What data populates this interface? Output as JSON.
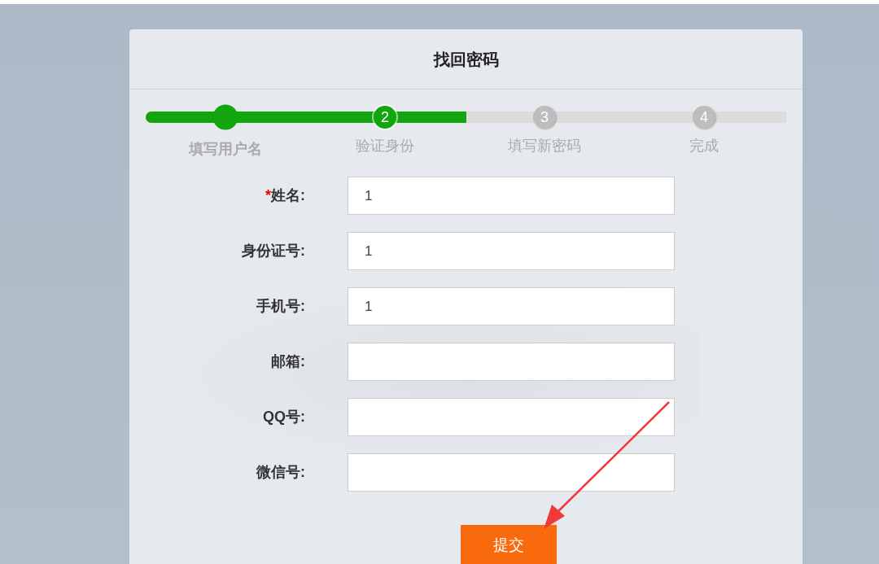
{
  "title": "找回密码",
  "progress": {
    "level": 0.5
  },
  "steps": [
    {
      "label": "填写用户名",
      "completed": true,
      "selected": false
    },
    {
      "number": "2",
      "label": "验证身份",
      "completed": false,
      "selected": true
    },
    {
      "number": "3",
      "label": "填写新密码",
      "completed": false,
      "selected": false
    },
    {
      "number": "4",
      "label": "完成",
      "completed": false,
      "selected": false
    }
  ],
  "fields": [
    {
      "required_mark": "*",
      "label": "姓名:",
      "value": "1"
    },
    {
      "label": "身份证号:",
      "value": "1"
    },
    {
      "label": "手机号:",
      "value": "1"
    },
    {
      "label": "邮箱:"
    },
    {
      "label": "QQ号:"
    },
    {
      "label": "微信号:"
    }
  ],
  "submit_button": "提交",
  "annotation": {
    "kind": "arrow"
  }
}
